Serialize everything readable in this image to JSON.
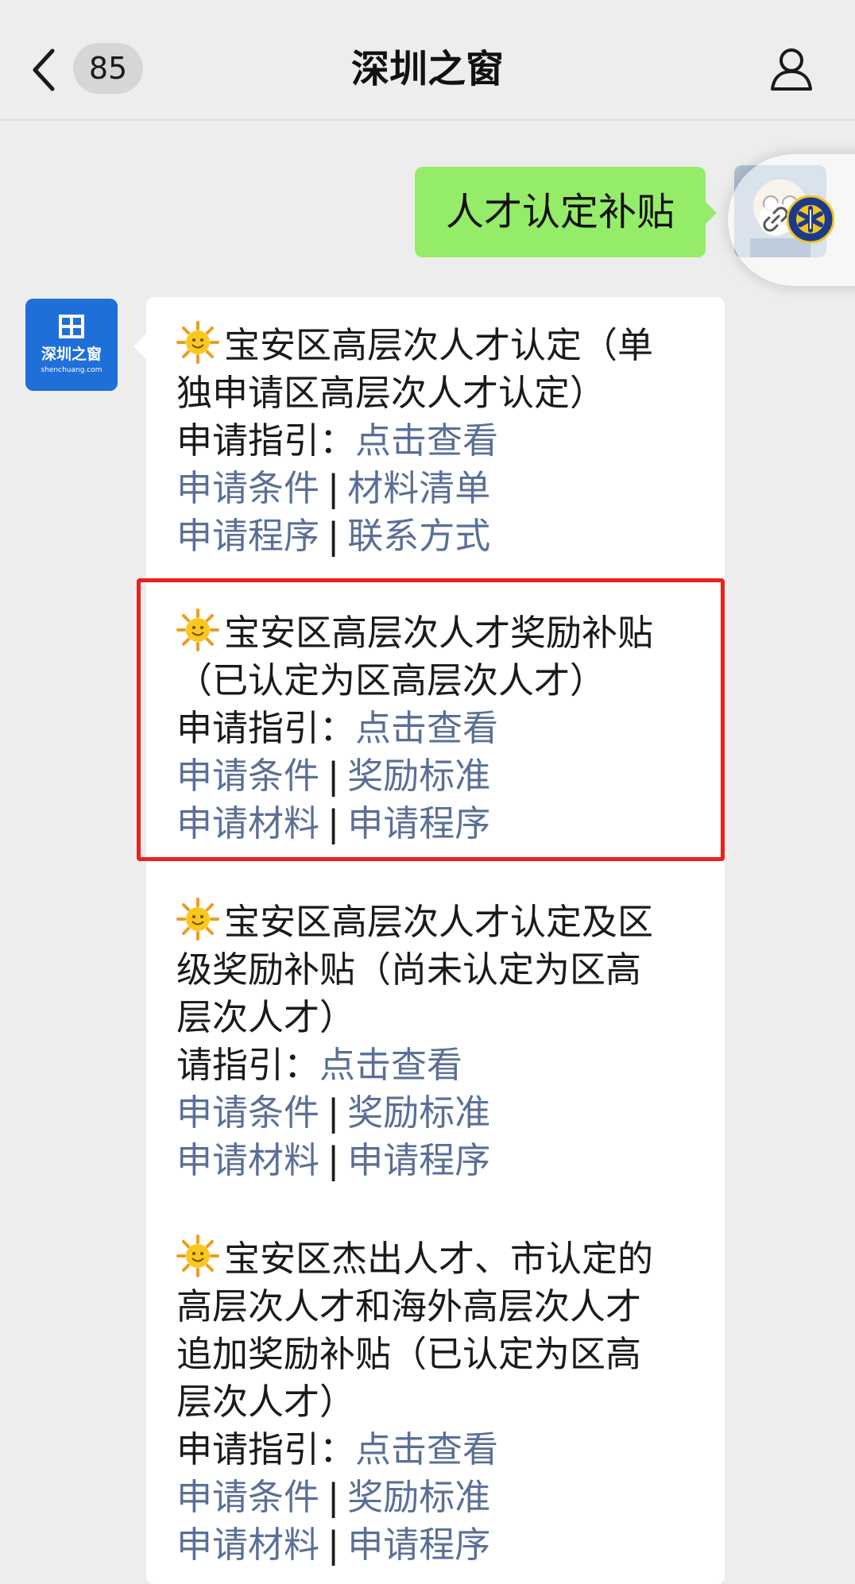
{
  "header": {
    "title": "深圳之窗",
    "unread_count": "85"
  },
  "outgoing_message": {
    "text": "人才认定补贴"
  },
  "official_account": {
    "logo_text": "深圳之窗",
    "logo_subtext": "shenchuang.com"
  },
  "sections": [
    {
      "title_lines": [
        "宝安区高层次人才认定（单",
        "独申请区高层次人才认定）"
      ],
      "guide_label": "申请指引：",
      "guide_link": "点击查看",
      "links_row1": [
        "申请条件",
        "材料清单"
      ],
      "links_row2": [
        "申请程序",
        "联系方式"
      ]
    },
    {
      "title_lines": [
        "宝安区高层次人才奖励补贴",
        "（已认定为区高层次人才）"
      ],
      "guide_label": "申请指引：",
      "guide_link": "点击查看",
      "links_row1": [
        "申请条件",
        "奖励标准"
      ],
      "links_row2": [
        "申请材料",
        "申请程序"
      ]
    },
    {
      "title_lines": [
        "宝安区高层次人才认定及区",
        "级奖励补贴（尚未认定为区高",
        "层次人才）"
      ],
      "guide_label": "请指引：",
      "guide_link": "点击查看",
      "links_row1": [
        "申请条件",
        "奖励标准"
      ],
      "links_row2": [
        "申请材料",
        "申请程序"
      ]
    },
    {
      "title_lines": [
        "宝安区杰出人才、市认定的",
        "高层次人才和海外高层次人才",
        "追加奖励补贴（已认定为区高",
        "层次人才）"
      ],
      "guide_label": "申请指引：",
      "guide_link": "点击查看",
      "links_row1": [
        "申请条件",
        "奖励标准"
      ],
      "links_row2": [
        "申请材料",
        "申请程序"
      ]
    }
  ],
  "separator": "|",
  "colors": {
    "background": "#ededed",
    "outgoing_bubble": "#95ec69",
    "link": "#5a6f97",
    "highlight": "#e8231d",
    "official_logo": "#1f6fd8"
  }
}
